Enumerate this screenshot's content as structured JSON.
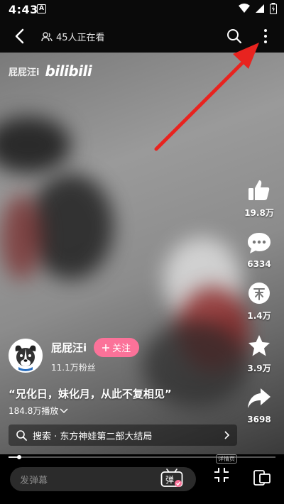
{
  "status_bar": {
    "time": "4:43",
    "notification_icon": "A"
  },
  "top_bar": {
    "viewers_text": "45人正在看"
  },
  "watermark": {
    "uploader_name": "屁屁汪i",
    "logo_text": "bilibili"
  },
  "actions": {
    "like_count": "19.8万",
    "comment_count": "6334",
    "coin_count": "1.4万",
    "favorite_count": "3.9万",
    "share_count": "3698"
  },
  "author": {
    "name": "屁屁汪i",
    "follow_label": "关注",
    "fans": "11.1万粉丝"
  },
  "video": {
    "title": "“兄化日，妹化月，从此不复相见”",
    "plays": "184.8万播放"
  },
  "search": {
    "text": "搜索 · 东方神娃第二部大结局"
  },
  "progress": {
    "played_fraction": 0.04
  },
  "bottom_bar": {
    "danmaku_placeholder": "发弹幕",
    "danmaku_button_label": "弹",
    "details_label": "详情页"
  },
  "colors": {
    "accent_pink": "#fb7299",
    "annotation_arrow": "#e8231f"
  }
}
